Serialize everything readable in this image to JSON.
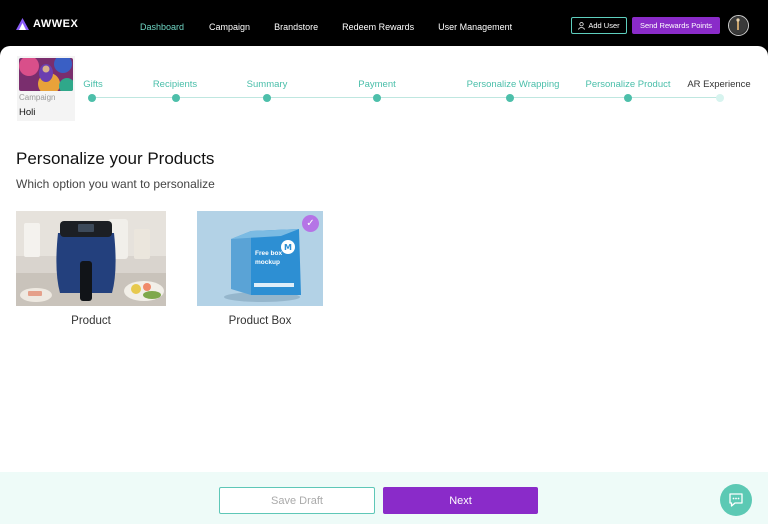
{
  "app": {
    "logo_text": "AWWEX"
  },
  "nav": {
    "items": [
      {
        "label": "Dashboard",
        "active": true
      },
      {
        "label": "Campaign",
        "active": false
      },
      {
        "label": "Brandstore",
        "active": false
      },
      {
        "label": "Redeem Rewards",
        "active": false
      },
      {
        "label": "User Management",
        "active": false
      }
    ]
  },
  "header": {
    "add_user_label": "Add User",
    "send_rewards_label": "Send Rewards Points"
  },
  "campaign": {
    "label": "Campaign",
    "name": "Holi"
  },
  "stepper": {
    "steps": [
      {
        "label": "Gifts",
        "state": "done"
      },
      {
        "label": "Recipients",
        "state": "done"
      },
      {
        "label": "Summary",
        "state": "done"
      },
      {
        "label": "Payment",
        "state": "done"
      },
      {
        "label": "Personalize Wrapping",
        "state": "done"
      },
      {
        "label": "Personalize Product",
        "state": "current"
      },
      {
        "label": "AR Experience",
        "state": "pending"
      }
    ]
  },
  "main": {
    "title": "Personalize your Products",
    "subtitle": "Which option you want to personalize",
    "options": [
      {
        "label": "Product",
        "selected": false
      },
      {
        "label": "Product Box",
        "selected": true,
        "box_text": "Free box mockup"
      }
    ]
  },
  "footer": {
    "save_draft_label": "Save Draft",
    "next_label": "Next"
  },
  "colors": {
    "accent_teal": "#4dbfaa",
    "accent_purple": "#8a2bc9",
    "topbar": "#000000"
  },
  "icons": [
    "logo-icon",
    "user-icon",
    "avatar-icon",
    "check-icon",
    "chat-icon"
  ]
}
